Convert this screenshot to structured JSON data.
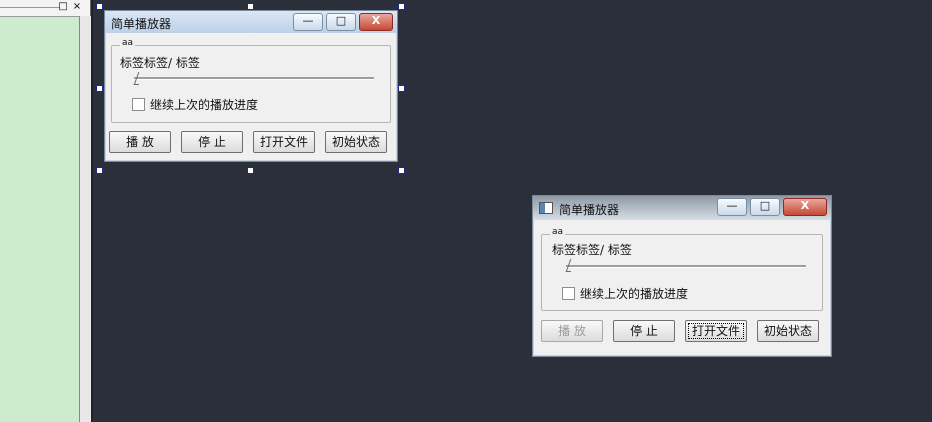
{
  "left_panel": {
    "restore_label": "□",
    "close_label": "×"
  },
  "windows": [
    {
      "title": "简单播放器",
      "ctrl_min": "—",
      "ctrl_max": "□",
      "ctrl_close": "X",
      "group_title": "aa",
      "label_text": "标签标签/ 标签",
      "slider_value": 0,
      "checkbox_label": "继续上次的播放进度",
      "buttons": [
        "播 放",
        "停 止",
        "打开文件",
        "初始状态"
      ]
    },
    {
      "title": "简单播放器",
      "ctrl_min": "—",
      "ctrl_max": "□",
      "ctrl_close": "X",
      "group_title": "aa",
      "label_text": "标签标签/ 标签",
      "slider_value": 0,
      "checkbox_label": "继续上次的播放进度",
      "buttons": [
        "播 放",
        "停 止",
        "打开文件",
        "初始状态"
      ]
    }
  ],
  "colors": {
    "background": "#2b2f39",
    "left_panel": "#cdeccf",
    "window_face": "#f0f0f0",
    "close_red": "#c54935"
  }
}
